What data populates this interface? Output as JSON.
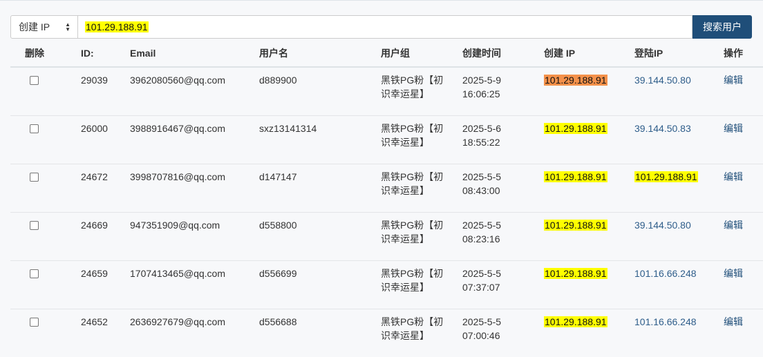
{
  "search": {
    "field_select": "创建 IP",
    "query": "101.29.188.91",
    "button_label": "搜索用户"
  },
  "table": {
    "headers": {
      "delete": "删除",
      "id": "ID:",
      "email": "Email",
      "username": "用户名",
      "group": "用户组",
      "created_time": "创建时间",
      "created_ip": "创建 IP",
      "login_ip": "登陆IP",
      "action": "操作"
    },
    "rows": [
      {
        "id": "29039",
        "email": "3962080560@qq.com",
        "username": "d889900",
        "group": "黑铁PG粉【初识幸运星】",
        "date": "2025-5-9",
        "time": "16:06:25",
        "created_ip": "101.29.188.91",
        "login_ip": "39.144.50.80",
        "action": "编辑"
      },
      {
        "id": "26000",
        "email": "3988916467@qq.com",
        "username": "sxz13141314",
        "group": "黑铁PG粉【初识幸运星】",
        "date": "2025-5-6",
        "time": "18:55:22",
        "created_ip": "101.29.188.91",
        "login_ip": "39.144.50.83",
        "action": "编辑"
      },
      {
        "id": "24672",
        "email": "3998707816@qq.com",
        "username": "d147147",
        "group": "黑铁PG粉【初识幸运星】",
        "date": "2025-5-5",
        "time": "08:43:00",
        "created_ip": "101.29.188.91",
        "login_ip": "101.29.188.91",
        "action": "编辑"
      },
      {
        "id": "24669",
        "email": "947351909@qq.com",
        "username": "d558800",
        "group": "黑铁PG粉【初识幸运星】",
        "date": "2025-5-5",
        "time": "08:23:16",
        "created_ip": "101.29.188.91",
        "login_ip": "39.144.50.80",
        "action": "编辑"
      },
      {
        "id": "24659",
        "email": "1707413465@qq.com",
        "username": "d556699",
        "group": "黑铁PG粉【初识幸运星】",
        "date": "2025-5-5",
        "time": "07:37:07",
        "created_ip": "101.29.188.91",
        "login_ip": "101.16.66.248",
        "action": "编辑"
      },
      {
        "id": "24652",
        "email": "2636927679@qq.com",
        "username": "d556688",
        "group": "黑铁PG粉【初识幸运星】",
        "date": "2025-5-5",
        "time": "07:00:46",
        "created_ip": "101.29.188.91",
        "login_ip": "101.16.66.248",
        "action": "编辑"
      }
    ]
  },
  "colors": {
    "highlight": "#ffff00",
    "highlight_active": "#f4914a",
    "button": "#1f4e79",
    "link": "#2e5d8a"
  }
}
